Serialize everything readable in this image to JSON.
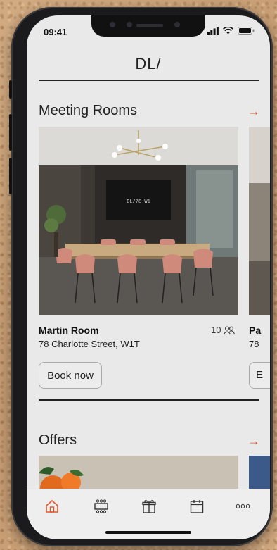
{
  "status_bar": {
    "time": "09:41"
  },
  "header": {
    "logo": "DL/"
  },
  "meeting_rooms": {
    "title": "Meeting Rooms",
    "arrow": "→",
    "rooms": [
      {
        "name": "Martin Room",
        "address": "78 Charlotte Street, W1T",
        "capacity": "10",
        "button": "Book now",
        "screen_text": "DL/78.W1"
      },
      {
        "name": "Pa",
        "address": "78",
        "button": "E"
      }
    ]
  },
  "offers": {
    "title": "Offers",
    "arrow": "→"
  },
  "tab_bar": {
    "items": [
      {
        "icon": "home-icon",
        "active": true
      },
      {
        "icon": "meeting-table-icon",
        "active": false
      },
      {
        "icon": "gift-icon",
        "active": false
      },
      {
        "icon": "calendar-icon",
        "active": false
      },
      {
        "icon": "more-icon",
        "label": "ooo",
        "active": false
      }
    ]
  },
  "colors": {
    "accent": "#e0592a",
    "screen_bg": "#e9e9e9",
    "text": "#222222"
  }
}
